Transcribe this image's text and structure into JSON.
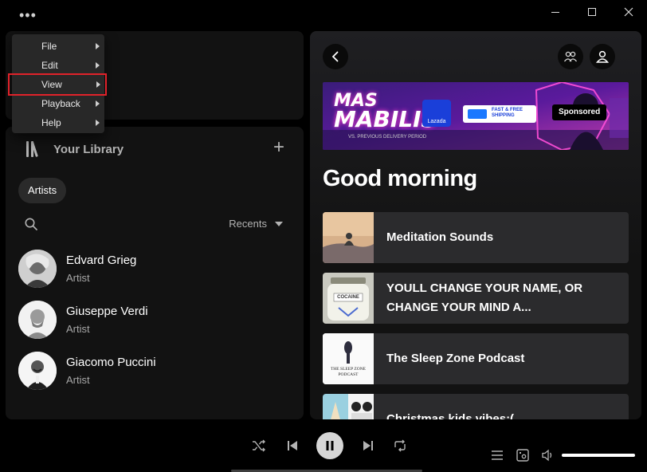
{
  "menu": {
    "items": [
      {
        "label": "File"
      },
      {
        "label": "Edit"
      },
      {
        "label": "View"
      },
      {
        "label": "Playback"
      },
      {
        "label": "Help"
      }
    ]
  },
  "library": {
    "title": "Your Library",
    "filter_chip": "Artists",
    "sort_label": "Recents",
    "artists": [
      {
        "name": "Edvard Grieg",
        "type": "Artist"
      },
      {
        "name": "Giuseppe Verdi",
        "type": "Artist"
      },
      {
        "name": "Giacomo Puccini",
        "type": "Artist"
      }
    ]
  },
  "banner": {
    "headline_1": "MAS",
    "headline_2": "MABILIS",
    "sub": "VS. PREVIOUS DELIVERY PERIOD",
    "brand": "Lazada",
    "shipping": "FAST & FREE SHIPPING",
    "sponsored": "Sponsored"
  },
  "main": {
    "greeting": "Good morning",
    "cards": [
      {
        "title": "Meditation Sounds"
      },
      {
        "title": "YOULL CHANGE YOUR NAME, OR CHANGE YOUR MIND A..."
      },
      {
        "title": "The Sleep Zone Podcast"
      },
      {
        "title": "Christmas kids vibes:("
      }
    ],
    "thumb_texts": {
      "cocaine": "COCAINE",
      "sleep": "THE SLEEP ZONE PODCAST"
    }
  },
  "colors": {
    "accent": "#1db954",
    "highlight": "#e0222a"
  }
}
